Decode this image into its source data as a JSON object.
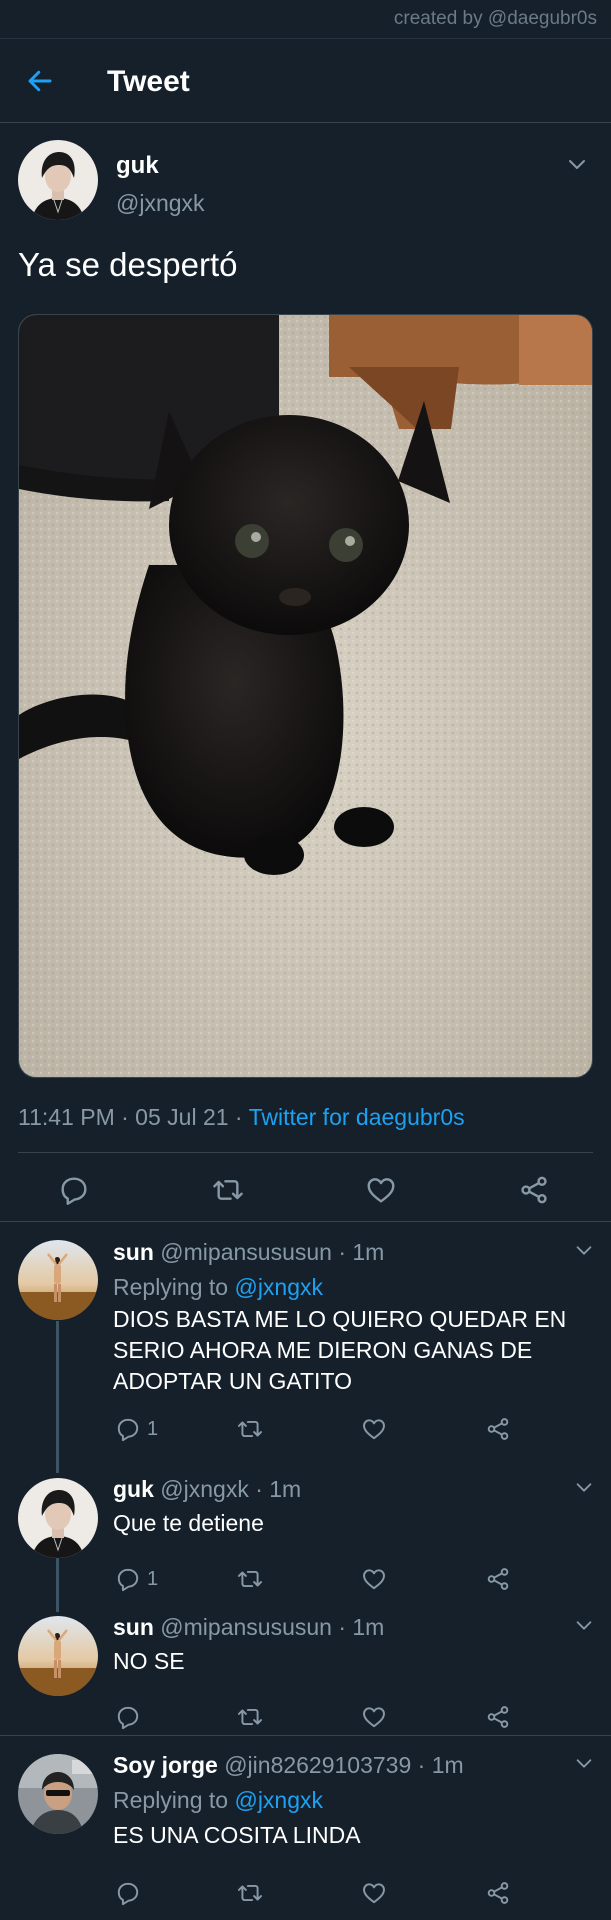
{
  "watermark": "created by @daegubr0s",
  "header": {
    "title": "Tweet"
  },
  "tweet": {
    "name": "guk",
    "handle": "@jxngxk",
    "text": "Ya se despertó",
    "time": "11:41 PM · 05 Jul 21 · ",
    "source": "Twitter for daegubr0s"
  },
  "replies": [
    {
      "name": "sun",
      "handle": "@mipansususun · 1m",
      "replying_label": "Replying to ",
      "replying_to": "@jxngxk",
      "text": "DIOS BASTA ME LO QUIERO QUEDAR EN SERIO AHORA ME DIERON GANAS DE ADOPTAR UN GATITO",
      "reply_count": "1"
    },
    {
      "name": "guk",
      "handle": "@jxngxk · 1m",
      "text": "Que te detiene",
      "reply_count": "1"
    },
    {
      "name": "sun",
      "handle": "@mipansususun · 1m",
      "text": "NO SE",
      "reply_count": ""
    },
    {
      "name": "Soy jorge",
      "handle": "@jin82629103739 · 1m",
      "replying_label": "Replying to ",
      "replying_to": "@jxngxk",
      "text": "ES UNA COSITA LINDA",
      "reply_count": ""
    }
  ],
  "colors": {
    "background": "#15202b",
    "accent": "#1da1f2",
    "secondary_text": "#8899a6",
    "divider": "#38444d"
  },
  "icons": [
    "back-arrow-icon",
    "chevron-down-icon",
    "reply-icon",
    "retweet-icon",
    "like-icon",
    "share-icon"
  ]
}
